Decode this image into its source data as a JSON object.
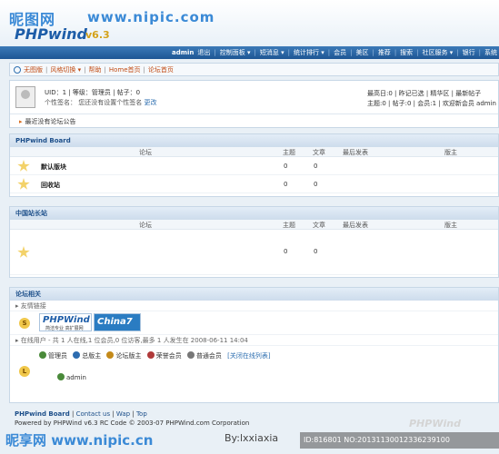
{
  "header": {
    "site_logo": "昵图网",
    "site_url": "www.nipic.com",
    "brand": "PHPwind",
    "version": "v6.3"
  },
  "topnav": {
    "user": "admin",
    "items": [
      "退出",
      "控制面板 ▾",
      "短消息 ▾",
      "统计排行 ▾",
      "会员",
      "美区",
      "推荐",
      "搜索",
      "社区服务 ▾",
      "银行",
      "系统"
    ]
  },
  "subnav": {
    "items": [
      "无图版",
      "风格切换 ▾",
      "帮助",
      "Home首页",
      "论坛首页"
    ]
  },
  "user_panel": {
    "line1": "UID：1 | 等级：管理员 | 帖子：0",
    "line2": "个性签名： 您还没有设置个性签名",
    "edit_link": "更改",
    "stats1": "最高日:0 | 昨记已选 | 精华区 | 最新帖子",
    "stats2": "主题:0 | 帖子:0 | 会员:1 | 欢迎新会员 admin",
    "notice": "最近没有论坛公告"
  },
  "columns": {
    "forum": "论坛",
    "topics": "主题",
    "posts": "文章",
    "last": "最后发表",
    "mod": "版主"
  },
  "section1": {
    "title": "PHPwind Board",
    "rows": [
      {
        "name": "默认版块",
        "topics": "0",
        "posts": "0"
      },
      {
        "name": "回收站",
        "topics": "0",
        "posts": "0"
      }
    ]
  },
  "section2": {
    "title": "中国站长站",
    "rows": [
      {
        "name": "",
        "topics": "0",
        "posts": "0"
      }
    ]
  },
  "section3": {
    "title": "论坛相关",
    "links_label": "友情链接",
    "logo1_text": "PHPWind",
    "logo1_sub": "简洁专业 高扩展网",
    "logo2_text": "China7",
    "online_text": "在线用户 - 共 1 人在线,1 位会员,0 位访客,最多 1 人发生在 2008-06-11 14:04",
    "legend": [
      "管理员",
      "总版主",
      "论坛版主",
      "荣誉会员",
      "普通会员"
    ],
    "legend_colors": [
      "#4a8a3a",
      "#2d6cb0",
      "#c48a1a",
      "#b03a3a",
      "#777777"
    ],
    "close_online": "[关闭在线列表]",
    "online_user": "admin"
  },
  "footer": {
    "line1_brand": "PHPwind Board",
    "links": [
      "Contact us",
      "Wap",
      "Top"
    ],
    "line2": "Powered by PHPWind v6.3 RC Code © 2003-07 PHPWind.com Corporation"
  },
  "watermark": {
    "left": "昵享网 www.nipic.cn",
    "by": "By:lxxiaxia",
    "id": "ID:816801 NO:20131130012336239100",
    "brand": "PHPWind"
  }
}
